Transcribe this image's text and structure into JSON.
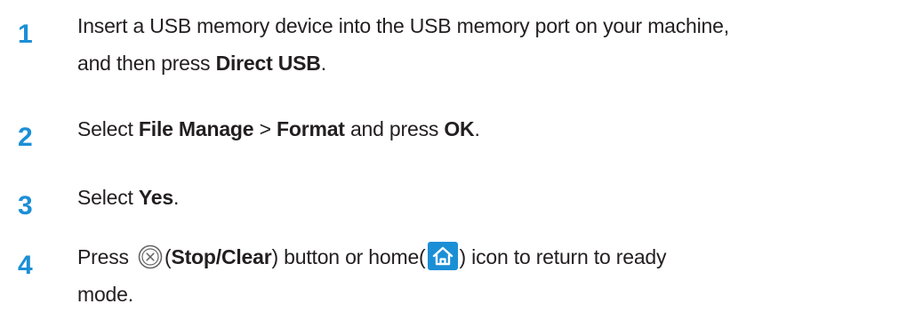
{
  "steps": [
    {
      "number": "1",
      "line1": "Insert a USB memory device into the USB memory port on your machine,",
      "line2_prefix": "and then press ",
      "line2_bold": "Direct USB",
      "line2_suffix": "."
    },
    {
      "number": "2",
      "t1": "Select ",
      "b1": "File Manage",
      "t2": " > ",
      "b2": "Format",
      "t3": " and press ",
      "b3": "OK",
      "t4": "."
    },
    {
      "number": "3",
      "t1": "Select ",
      "b1": "Yes",
      "t2": "."
    },
    {
      "number": "4",
      "t1": "Press ",
      "t2": "(",
      "b1": "Stop/Clear",
      "t3": ") button or home(",
      "t4": ") icon to return to ready",
      "line2": "mode.",
      "stop_icon": "stop-clear-icon",
      "home_icon": "home-icon"
    }
  ],
  "colors": {
    "step_number": "#1b8fd6",
    "body_text": "#231f20",
    "home_icon_bg": "#1b8fd6"
  }
}
